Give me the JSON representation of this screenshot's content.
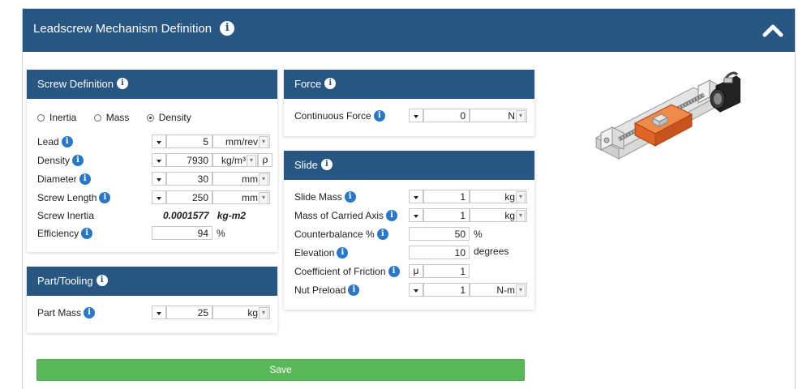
{
  "header": {
    "title": "Leadscrew Mechanism Definition"
  },
  "screw": {
    "title": "Screw Definition",
    "radios": [
      {
        "label": "Inertia",
        "selected": false
      },
      {
        "label": "Mass",
        "selected": false
      },
      {
        "label": "Density",
        "selected": true
      }
    ],
    "lead": {
      "label": "Lead",
      "value": "5",
      "unit": "mm/rev"
    },
    "density": {
      "label": "Density",
      "value": "7930",
      "unit": "kg/m³",
      "symbol": "ρ"
    },
    "diameter": {
      "label": "Diameter",
      "value": "30",
      "unit": "mm"
    },
    "length": {
      "label": "Screw Length",
      "value": "250",
      "unit": "mm"
    },
    "inertia": {
      "label": "Screw Inertia",
      "value": "0.0001577   kg-m2"
    },
    "efficiency": {
      "label": "Efficiency",
      "value": "94",
      "unit": "%"
    }
  },
  "part": {
    "title": "Part/Tooling",
    "mass": {
      "label": "Part Mass",
      "value": "25",
      "unit": "kg"
    }
  },
  "force": {
    "title": "Force",
    "continuous": {
      "label": "Continuous Force",
      "value": "0",
      "unit": "N"
    }
  },
  "slide": {
    "title": "Slide",
    "slide_mass": {
      "label": "Slide Mass",
      "value": "1",
      "unit": "kg"
    },
    "carried": {
      "label": "Mass of Carried Axis",
      "value": "1",
      "unit": "kg"
    },
    "counterbalance": {
      "label": "Counterbalance %",
      "value": "50",
      "unit": "%"
    },
    "elevation": {
      "label": "Elevation",
      "value": "10",
      "unit": "degrees"
    },
    "friction": {
      "label": "Coefficient of Friction",
      "symbol": "μ",
      "value": "1"
    },
    "preload": {
      "label": "Nut Preload",
      "value": "1",
      "unit": "N-m"
    }
  },
  "save_label": "Save",
  "colors": {
    "header": "#285682",
    "save": "#5bb85a",
    "info": "#2a78c5",
    "carriage": "#e8692a"
  }
}
